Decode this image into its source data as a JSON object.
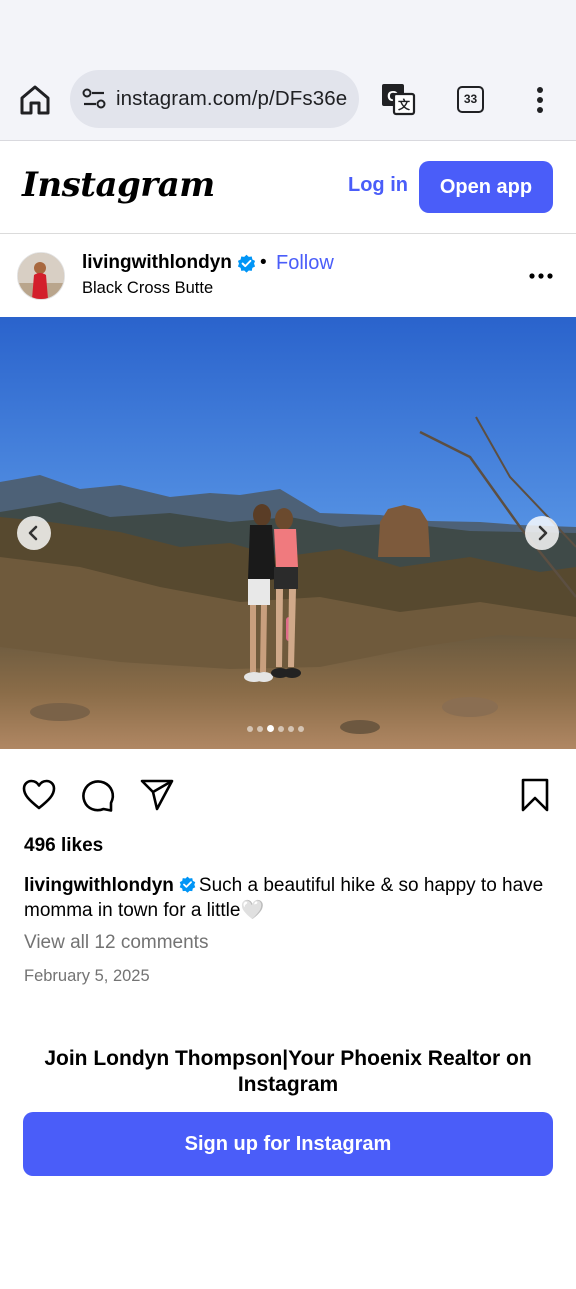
{
  "browser": {
    "url": "instagram.com/p/DFs36er",
    "tab_count": "33",
    "icons": [
      "home-icon",
      "site-settings-icon",
      "translate-icon",
      "tabs-icon",
      "more-vert-icon"
    ]
  },
  "header": {
    "logo": "Instagram",
    "login_label": "Log in",
    "open_app_label": "Open app"
  },
  "post": {
    "username": "livingwithlondyn",
    "separator": "•",
    "follow_label": "Follow",
    "location": "Black Cross Butte",
    "carousel": {
      "total_slides": 6,
      "active_slide": 3
    },
    "likes": "496 likes",
    "caption_user": "livingwithlondyn",
    "caption_text": "Such a beautiful hike & so happy to have momma in town for a little🤍",
    "view_comments": "View all 12 comments",
    "date": "February 5, 2025"
  },
  "footer": {
    "join_text": "Join Londyn Thompson|Your Phoenix Realtor on Instagram",
    "signup_label": "Sign up for Instagram"
  },
  "colors": {
    "accent": "#4a5df9",
    "verified": "#0095f6",
    "muted_text": "#737373"
  }
}
